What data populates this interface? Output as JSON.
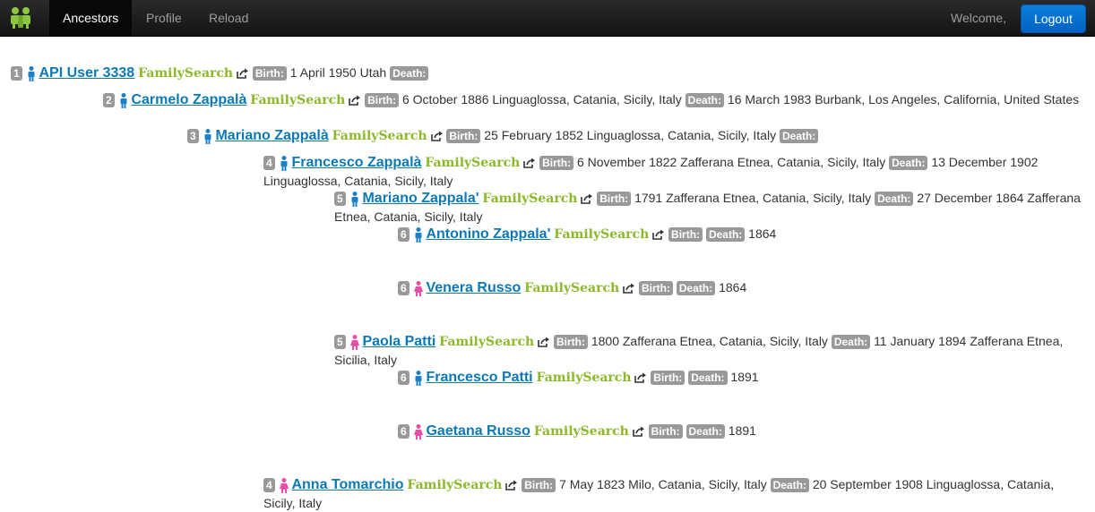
{
  "nav": {
    "items": [
      "Ancestors",
      "Profile",
      "Reload"
    ],
    "welcome": "Welcome,",
    "logout": "Logout"
  },
  "labels": {
    "birth": "Birth:",
    "death": "Death:",
    "source": "FamilySearch"
  },
  "colors": {
    "male": "#1a7fc4",
    "female": "#e84fa6",
    "link": "#0b79b8",
    "source": "#8cb82a",
    "logout": "#0a6fd0"
  },
  "people": [
    {
      "gen": "1",
      "gender": "male",
      "name": "API User 3338",
      "birth": "1 April 1950 Utah",
      "death": ""
    },
    {
      "gen": "2",
      "gender": "male",
      "name": "Carmelo Zappalà",
      "birth": "6 October 1886 Linguaglossa, Catania, Sicily, Italy",
      "death": "16 March 1983 Burbank, Los Angeles, California, United States"
    },
    {
      "gen": "3",
      "gender": "male",
      "name": "Mariano Zappalà",
      "birth": "25 February 1852 Linguaglossa, Catania, Sicily, Italy",
      "death": ""
    },
    {
      "gen": "4",
      "gender": "male",
      "name": "Francesco Zappalà",
      "birth": "6 November 1822 Zafferana Etnea, Catania, Sicily, Italy",
      "death": "13 December 1902 Linguaglossa, Catania, Sicily, Italy"
    },
    {
      "gen": "5",
      "gender": "male",
      "name": "Mariano Zappala'",
      "birth": "1791 Zafferana Etnea, Catania, Sicily, Italy",
      "death": "27 December 1864 Zafferana Etnea, Catania, Sicily, Italy"
    },
    {
      "gen": "6",
      "gender": "male",
      "name": "Antonino Zappala'",
      "birth": "",
      "death": "1864"
    },
    {
      "gen": "6",
      "gender": "female",
      "name": "Venera Russo",
      "birth": "",
      "death": "1864"
    },
    {
      "gen": "5",
      "gender": "female",
      "name": "Paola Patti",
      "birth": "1800 Zafferana Etnea, Catania, Sicily, Italy",
      "death": "11 January 1894 Zafferana Etnea, Sicilia, Italy"
    },
    {
      "gen": "6",
      "gender": "male",
      "name": "Francesco Patti",
      "birth": "",
      "death": "1891"
    },
    {
      "gen": "6",
      "gender": "female",
      "name": "Gaetana Russo",
      "birth": "",
      "death": "1891"
    },
    {
      "gen": "4",
      "gender": "female",
      "name": "Anna Tomarchio",
      "birth": "7 May 1823 Milo, Catania, Sicily, Italy",
      "death": "20 September 1908 Linguaglossa, Catania, Sicily, Italy"
    }
  ]
}
